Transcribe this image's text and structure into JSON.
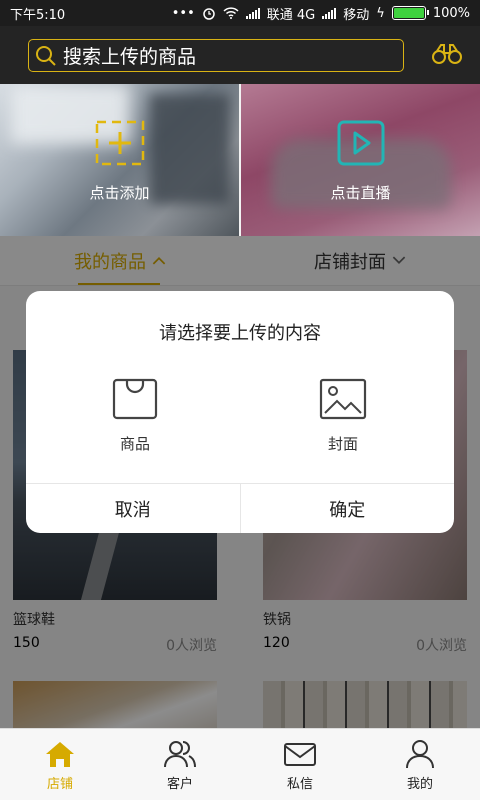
{
  "status_bar": {
    "time": "下午5:10",
    "carrier1": "联通 4G",
    "carrier2": "移动",
    "battery": "100%",
    "battery_level": 1.0
  },
  "search": {
    "text": "搜索上传的商品"
  },
  "tiles": [
    {
      "label": "点击添加",
      "icon": "plus-icon"
    },
    {
      "label": "点击直播",
      "icon": "play-icon"
    }
  ],
  "tabs": [
    {
      "label": "我的商品",
      "active": true
    },
    {
      "label": "店铺封面",
      "active": false
    }
  ],
  "products": [
    {
      "name": "篮球鞋",
      "price": "150",
      "views": "0人浏览"
    },
    {
      "name": "铁锅",
      "price": "120",
      "views": "0人浏览"
    }
  ],
  "dialog": {
    "title": "请选择要上传的内容",
    "options": [
      {
        "label": "商品",
        "icon": "shopping-bag-icon"
      },
      {
        "label": "封面",
        "icon": "image-icon"
      }
    ],
    "cancel": "取消",
    "confirm": "确定"
  },
  "bottom_nav": [
    {
      "label": "店铺",
      "icon": "home-icon",
      "active": true
    },
    {
      "label": "客户",
      "icon": "users-icon",
      "active": false
    },
    {
      "label": "私信",
      "icon": "mail-icon",
      "active": false
    },
    {
      "label": "我的",
      "icon": "person-icon",
      "active": false
    }
  ],
  "colors": {
    "accent": "#d6aa00",
    "header": "#242424",
    "play_teal": "#22b5b5"
  }
}
